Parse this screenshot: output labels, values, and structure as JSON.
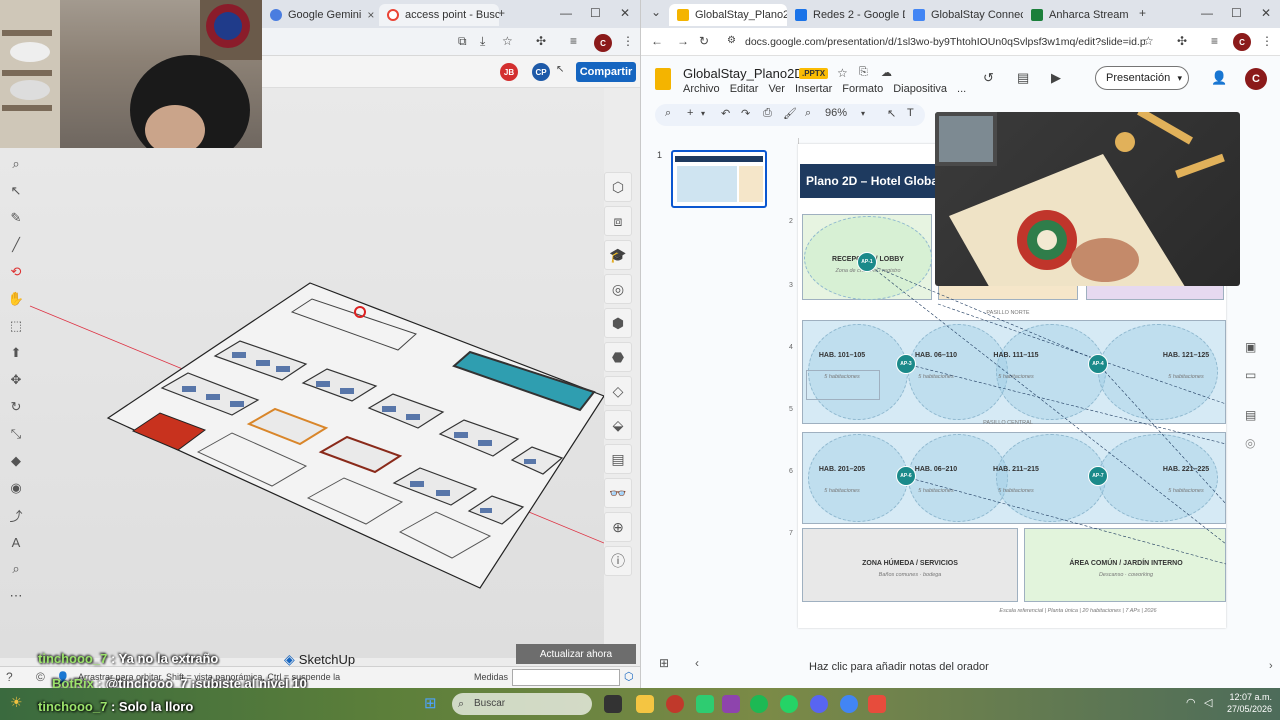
{
  "left_window": {
    "tabs": [
      {
        "label": "Google Gemini"
      },
      {
        "label": "access point - Busc"
      }
    ],
    "new_tab_symbol": "+",
    "share_button": "Compartir",
    "collaborators": [
      "JB",
      "CP"
    ],
    "update_button": "Actualizar ahora",
    "app_label": "SketchUp",
    "status_hint": "Arrastrar para orbitar. Shift = vista panorámica, Ctrl = suspende la",
    "measures_label": "Medidas"
  },
  "chat": [
    {
      "user": "tinchooo_7",
      "message": "Ya no la extraño"
    },
    {
      "user": "BotRix",
      "message": "@tinchooo_7 ¡subiste al nivel 10"
    },
    {
      "user": "tinchooo_7",
      "message": "Solo la lloro"
    }
  ],
  "right_window": {
    "tabs": [
      {
        "label": "GlobalStay_Plano2D"
      },
      {
        "label": "Redes 2 - Google D"
      },
      {
        "label": "GlobalStay Connect"
      },
      {
        "label": "Anharca Stream"
      }
    ],
    "url": "docs.google.com/presentation/d/1sl3wo-by9ThtohIOUn0qSvlpsf3w1mq/edit?slide=id.p1#sl...",
    "doc_title": "GlobalStay_Plano2D",
    "badge": ".PPTX",
    "menu": [
      "Archivo",
      "Editar",
      "Ver",
      "Insertar",
      "Formato",
      "Diapositiva",
      "..."
    ],
    "present_button": "Presentación",
    "avatar_letter": "C",
    "zoom": "96%",
    "slide_number": "1",
    "ruler_numbers": [
      "1",
      "2",
      "3",
      "4",
      "5",
      "6",
      "7"
    ],
    "notes_placeholder": "Haz clic para añadir notas del orador"
  },
  "slide": {
    "title": "Plano 2D – Hotel Globa",
    "reception": {
      "label": "RECEPCIÓN / LOBBY",
      "sub": "Zona de check-in / registro"
    },
    "corridor_north": "PASILLO NORTE",
    "corridor_center": "PASILLO CENTRAL",
    "rooms_top": [
      {
        "label": "HAB. 101–105",
        "sub": "5 habitaciones"
      },
      {
        "label": "HAB. 06–110",
        "sub": "5 habitaciones"
      },
      {
        "label": "HAB. 111–115",
        "sub": "5 habitaciones"
      },
      {
        "label": "HAB. 121–125",
        "sub": "5 habitaciones"
      }
    ],
    "rooms_bottom": [
      {
        "label": "HAB. 201–205",
        "sub": "5 habitaciones"
      },
      {
        "label": "HAB. 06–210",
        "sub": "5 habitaciones"
      },
      {
        "label": "HAB. 211–215",
        "sub": "5 habitaciones"
      },
      {
        "label": "HAB. 221–225",
        "sub": "5 habitaciones"
      }
    ],
    "wet_zone": {
      "label": "ZONA HÚMEDA / SERVICIOS",
      "sub": "Baños comunes · bodega"
    },
    "common_area": {
      "label": "ÁREA COMÚN / JARDÍN INTERNO",
      "sub": "Descanso · coworking"
    },
    "ap_labels": [
      "AP-1",
      "AP-2",
      "AP-3",
      "AP-4",
      "AP-5",
      "AP-6",
      "AP-7"
    ],
    "footer": "Escala referencial | Planta única | 20 habitaciones | 7 APs | 2026"
  },
  "taskbar": {
    "search_placeholder": "Buscar",
    "time": "12:07 a.m.",
    "date": "27/05/2026"
  },
  "colors": {
    "slides_yellow": "#f4b400",
    "share_blue": "#1565c0",
    "ap_teal": "#1b8a8a",
    "slide_header": "#1e3a5f"
  }
}
